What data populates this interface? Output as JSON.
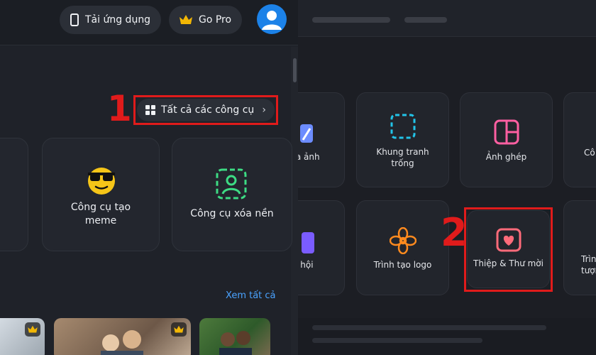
{
  "left": {
    "topbar": {
      "app_label": "Tải ứng dụng",
      "pro_label": "Go Pro"
    },
    "step_one": "1",
    "all_tools_label": "Tất cả các công cụ",
    "tools": [
      {
        "label_line1": "Công cụ tạo",
        "label_line2": "meme"
      },
      {
        "label_line1": "Công cụ xóa nền",
        "label_line2": ""
      }
    ],
    "see_all_label": "Xem tất cả"
  },
  "right": {
    "step_two": "2",
    "row1": [
      {
        "label_line1": "sửa ảnh",
        "label_line2": ""
      },
      {
        "label_line1": "Khung tranh",
        "label_line2": "trống"
      },
      {
        "label_line1": "Ảnh ghép",
        "label_line2": ""
      },
      {
        "label_line1": "Cô",
        "label_line2": ""
      }
    ],
    "row2": [
      {
        "label_line1": "xã hội",
        "label_line2": ""
      },
      {
        "label_line1": "Trình tạo logo",
        "label_line2": ""
      },
      {
        "label_line1": "Thiệp & Thư mời",
        "label_line2": ""
      },
      {
        "label_line1": "Trìn",
        "label_line2": "tượn"
      }
    ]
  },
  "colors": {
    "annotation_red": "#e01b1b",
    "link_blue": "#4aa3ff",
    "crown_gold": "#f2b705",
    "avatar_blue": "#1c82e8"
  }
}
